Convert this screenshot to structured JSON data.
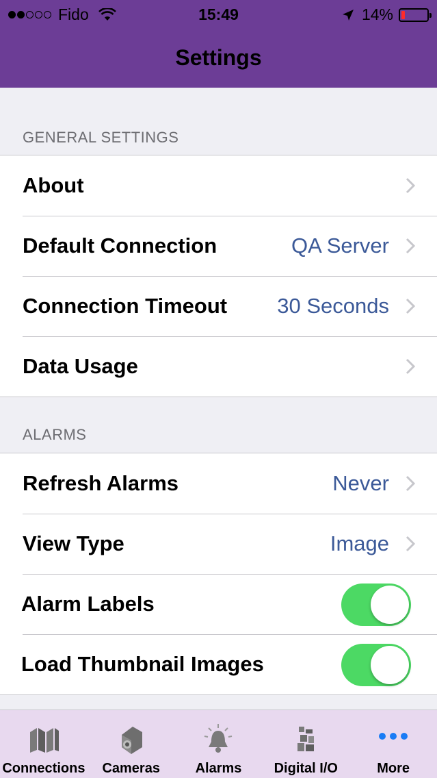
{
  "status_bar": {
    "carrier": "Fido",
    "time": "15:49",
    "battery": "14%",
    "battery_level": 0.14,
    "signal_bars": 2
  },
  "nav": {
    "title": "Settings"
  },
  "general": {
    "header": "GENERAL SETTINGS",
    "rows": [
      {
        "label": "About",
        "value": ""
      },
      {
        "label": "Default Connection",
        "value": "QA Server"
      },
      {
        "label": "Connection Timeout",
        "value": "30 Seconds"
      },
      {
        "label": "Data Usage",
        "value": ""
      }
    ]
  },
  "alarms": {
    "header": "ALARMS",
    "rows": [
      {
        "label": "Refresh Alarms",
        "value": "Never"
      },
      {
        "label": "View Type",
        "value": "Image"
      },
      {
        "label": "Alarm Labels",
        "toggle": true
      },
      {
        "label": "Load Thumbnail Images",
        "toggle": true
      }
    ]
  },
  "tabbar": {
    "tabs": [
      {
        "label": "Connections",
        "icon": "connections-icon"
      },
      {
        "label": "Cameras",
        "icon": "camera-icon"
      },
      {
        "label": "Alarms",
        "icon": "alarm-bell-icon"
      },
      {
        "label": "Digital I/O",
        "icon": "digital-io-icon"
      },
      {
        "label": "More",
        "icon": "more-dots-icon",
        "active": true
      }
    ]
  },
  "colors": {
    "nav_bg": "#6c3d96",
    "tabbar_bg": "#e8d9ef",
    "value_text": "#3b5998",
    "toggle_on": "#4cd964",
    "active_tab": "#1a7cf5"
  }
}
